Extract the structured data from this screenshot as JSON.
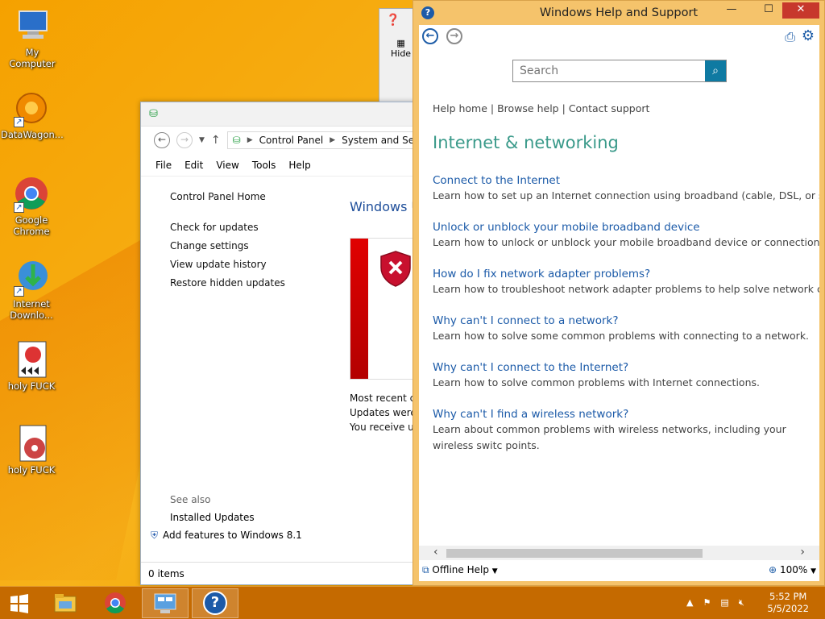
{
  "desktop": {
    "icons": [
      {
        "label": "My Computer"
      },
      {
        "label": "DataWagon..."
      },
      {
        "label": "Google Chrome"
      },
      {
        "label": "Internet Downlo..."
      },
      {
        "label": "holy FUCK"
      },
      {
        "label": "holy FUCK"
      }
    ]
  },
  "control_panel": {
    "breadcrumb": [
      "Control Panel",
      "System and Secu"
    ],
    "menu": [
      "File",
      "Edit",
      "View",
      "Tools",
      "Help"
    ],
    "sidebar": {
      "home": "Control Panel Home",
      "links": [
        "Check for updates",
        "Change settings",
        "View update history",
        "Restore hidden updates"
      ],
      "see_also_heading": "See also",
      "see_also": [
        "Installed Updates",
        "Add features to Windows 8.1"
      ]
    },
    "main_title": "Windows U",
    "status_lines": [
      "Most recent ch",
      "Updates were i",
      "You receive up"
    ],
    "status_bar": "0 items"
  },
  "help": {
    "window_title": "Windows Help and Support",
    "search_placeholder": "Search",
    "top_links": {
      "home": "Help home",
      "browse": "Browse help",
      "contact": "Contact support",
      "sep": "|"
    },
    "heading": "Internet & networking",
    "topics": [
      {
        "title": "Connect to the Internet",
        "desc": "Learn how to set up an Internet connection using broadband (cable, DSL, or satellite"
      },
      {
        "title": "Unlock or unblock your mobile broadband device",
        "desc": "Learn how to unlock or unblock your mobile broadband device or connection."
      },
      {
        "title": "How do I fix network adapter problems?",
        "desc": "Learn how to troubleshoot network adapter problems to help solve network connec"
      },
      {
        "title": "Why can't I connect to a network?",
        "desc": "Learn how to solve some common problems with connecting to a network."
      },
      {
        "title": "Why can't I connect to the Internet?",
        "desc": "Learn how to solve common problems with Internet connections."
      },
      {
        "title": "Why can't I find a wireless network?",
        "desc": "Learn about common problems with wireless networks, including your wireless switc points."
      }
    ],
    "status": {
      "offline": "Offline Help",
      "zoom": "100%"
    }
  },
  "behind_window": {
    "hide_label": "Hide"
  },
  "taskbar": {
    "time": "5:52 PM",
    "date": "5/5/2022"
  },
  "colors": {
    "wallpaper": "#f5a100",
    "help_frame": "#f5c36b",
    "link": "#1b5aa8",
    "heading": "#3a9a8a",
    "close": "#c7382c"
  }
}
